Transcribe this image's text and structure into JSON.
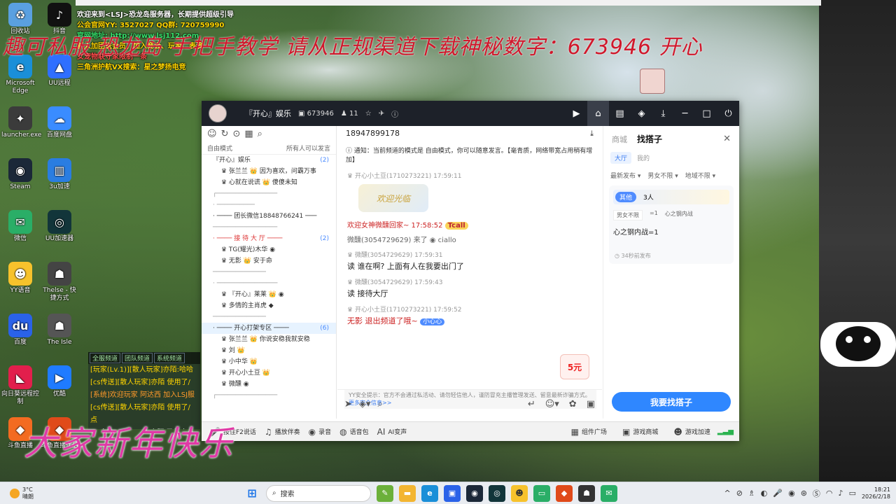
{
  "desktop": {
    "icons": [
      {
        "label": "回收站",
        "glyph": "♻",
        "color": "#5aa0e0"
      },
      {
        "label": "抖音",
        "glyph": "♪",
        "color": "#111111"
      },
      {
        "label": "Microsoft Edge",
        "glyph": "e",
        "color": "#1a8fd8"
      },
      {
        "label": "UU远程",
        "glyph": "▲",
        "color": "#2f6fff"
      },
      {
        "label": "launcher.exe",
        "glyph": "✦",
        "color": "#3b3b3b"
      },
      {
        "label": "百度网盘",
        "glyph": "☁",
        "color": "#3a8cff"
      },
      {
        "label": "Steam",
        "glyph": "◉",
        "color": "#1b2838"
      },
      {
        "label": "3u加速",
        "glyph": "▥",
        "color": "#2a7de1"
      },
      {
        "label": "微信",
        "glyph": "✉",
        "color": "#2aae67"
      },
      {
        "label": "UU加速器",
        "glyph": "◎",
        "color": "#12353a"
      },
      {
        "label": "YY语音",
        "glyph": "☻",
        "color": "#f7c22c"
      },
      {
        "label": "Thelse - 快捷方式",
        "glyph": "☗",
        "color": "#444444"
      },
      {
        "label": "百度",
        "glyph": "du",
        "color": "#2a62e8"
      },
      {
        "label": "The Isle",
        "glyph": "☗",
        "color": "#555555"
      },
      {
        "label": "向日葵远程控制",
        "glyph": "◣",
        "color": "#e21f4c"
      },
      {
        "label": "优酷",
        "glyph": "▶",
        "color": "#1f7bff"
      },
      {
        "label": "斗鱼直播",
        "glyph": "◆",
        "color": "#f36b21"
      },
      {
        "label": "斗鱼直播伴侣",
        "glyph": "◆",
        "color": "#e04a1a"
      }
    ]
  },
  "overlay": {
    "lines": [
      {
        "text": "欢迎来到<LSJ>恐龙岛服务器，长期提供超级引导",
        "color": "#ffffff"
      },
      {
        "text": "公会官网YY: 3527027 QQ群: 720759990",
        "color": "#ffd400"
      },
      {
        "text": "官网地址: http://www.lsj112.com",
        "color": "#35e06a"
      },
      {
        "text": "新人加团送会员，加入商会、玩家、表演",
        "color": "#ffd400"
      },
      {
        "text": "女宠物联守家限制一条",
        "color": "#ff4a4a"
      },
      {
        "text": "三角洲护航VX搜索：星之梦扬电竞",
        "color": "#ffd400"
      }
    ],
    "banner": "趣可私服 恐龙岛 手把手教学  请从正规渠道下载神秘数字：673946   开心",
    "new_year": "大家新年快乐"
  },
  "game_chat": {
    "tabs": [
      "全服频道",
      "团队频道",
      "系统频道"
    ],
    "lines": [
      {
        "text": "[玩家(Lv.1)][散人玩家]亦陌:哈哈",
        "color": "#ffd400"
      },
      {
        "text": "[cs传送][散人玩家]亦陌 使用了/",
        "color": "#ffd400"
      },
      {
        "text": "[系统]欢迎玩家 阿达西 加入LSJ服",
        "color": "#ff9a2a"
      },
      {
        "text": "[cs传送][散人玩家]亦陌 使用了/",
        "color": "#ffd400"
      },
      {
        "text": "点",
        "color": "#ffd400"
      },
      {
        "text": "[玩家(Lv.1)][LOL] 亦陌 已经来了",
        "color": "#ffffff"
      },
      {
        "text": "[系统]欢迎玩家 ov nwjd 加入LSJ服",
        "color": "#ff9a2a"
      }
    ]
  },
  "yy": {
    "title": "『开心』娱乐",
    "channel_id": "673946",
    "online": "11",
    "left": {
      "mode_label": "自由模式",
      "mode_right": "所有人可以发言",
      "rows": [
        {
          "text": "『开心』娱乐",
          "count": "(2)",
          "type": "root"
        },
        {
          "text": "♛ 张兰兰 👑 因为喜欢，问霸万事",
          "type": "user"
        },
        {
          "text": "♛ 心就在说谎 👑 傻傻未知",
          "type": "user"
        },
        {
          "text": "┌────────────────",
          "type": "sep"
        },
        {
          "text": "· ──────────",
          "type": "sep"
        },
        {
          "text": "· ──── 团长微信18848766241 ───",
          "type": "ch"
        },
        {
          "text": "─────────────────",
          "type": "sep"
        },
        {
          "text": "· ──── 接 待 大 厅 ────",
          "count": "(2)",
          "type": "red"
        },
        {
          "text": "♛ TG(耀光)木华 ◉",
          "type": "user"
        },
        {
          "text": "♛ 无影 👑 安于命",
          "type": "user"
        },
        {
          "text": "──────────────",
          "type": "sep"
        },
        {
          "text": "· ────────────────",
          "type": "sep"
        },
        {
          "text": "♛ 『开心』莱莱 👑 ◉",
          "type": "user"
        },
        {
          "text": "♛ 多情的主肖虎 ◆",
          "type": "user"
        },
        {
          "text": "──────────────",
          "type": "sep"
        },
        {
          "text": "· ──── 开心打架专区 ────",
          "count": "(6)",
          "type": "hl"
        },
        {
          "text": "♛ 张兰兰 👑 你说安稳我就安稳",
          "type": "user"
        },
        {
          "text": "♛ 刘 👑",
          "type": "user"
        },
        {
          "text": "♛ 小中华 👑",
          "type": "user"
        },
        {
          "text": "♛ 开心小土豆 👑",
          "type": "user"
        },
        {
          "text": "♛ 微醺 ◉",
          "type": "user"
        },
        {
          "text": "┌────────────────",
          "type": "sep"
        }
      ]
    },
    "mid": {
      "phone": "18947899178",
      "notice": "通知：当前频道的模式是 自由模式，你可以随意发言。【毫青质，网络带宽占用稍有增加】",
      "messages": [
        {
          "head": "开心小土豆(1710273221)  17:59:11",
          "text": ""
        },
        {
          "welcome": "欢迎女神微醺回家~ 17:58:52"
        },
        {
          "join": "微醺(3054729629) 来了  ◉ ciallo"
        },
        {
          "head": "微醺(3054729629)  17:59:31",
          "text": "读 谁在啊? 上面有人在我要出门了"
        },
        {
          "head": "微醺(3054729629)  17:59:43",
          "text": "读 接待大厅"
        },
        {
          "head": "开心小土豆(1710273221)  17:59:52",
          "text": "无影 退出频道了哦~"
        }
      ],
      "sticker": "欢迎光临",
      "welcome_tag": "Tcall",
      "small_tag": "小心心",
      "gift": "5元",
      "safety_text": "YY安全提示：官方不会通过私活动、请勿轻信他人，谨防冒充主播管理发送、留意最新诈骗方式。",
      "safety_link": "更多安全信息>>"
    },
    "right": {
      "tab_a": "商城",
      "tab_b": "找搭子",
      "sub_on": "大厅",
      "sub_off": "我的",
      "filters": [
        "最新发布 ▾",
        "男女不限 ▾",
        "地域不限 ▾"
      ],
      "card_pill": "其他",
      "card_count": "3人",
      "card_tags": [
        "男女不限",
        "=1",
        "心之钢内战"
      ],
      "card_line": "心之钢内战=1",
      "card_time": "34秒前发布",
      "find_button": "我要找搭子"
    },
    "bottom": {
      "items": [
        "按住F2说话",
        "播放伴奏",
        "录音",
        "语音包",
        "AI变声"
      ],
      "right": [
        "组件广场",
        "游戏商城",
        "游戏加速"
      ]
    }
  },
  "taskbar": {
    "temp": "3°C",
    "weather": "晴朗",
    "search_placeholder": "搜索",
    "time": "18:21",
    "date": "2026/2/18"
  }
}
